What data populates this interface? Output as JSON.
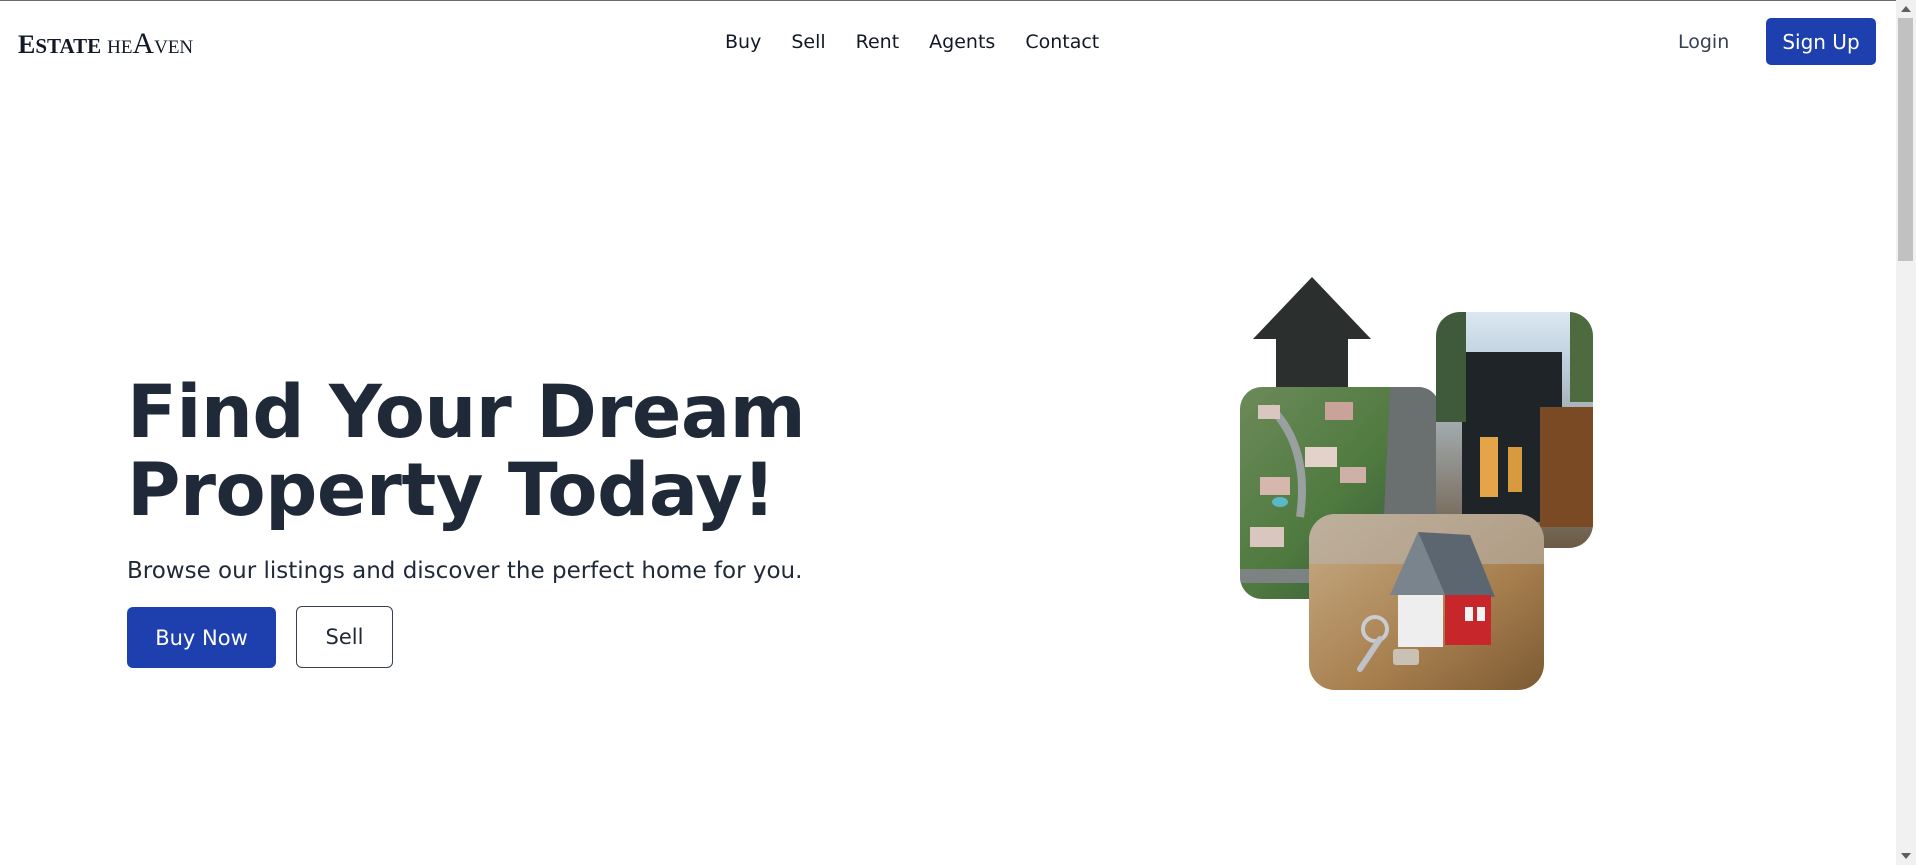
{
  "brand": {
    "word1_initial": "E",
    "word1_rest": "STATE",
    "word2_a": "HE",
    "word2_b": "A",
    "word2_c": "VEN"
  },
  "nav": {
    "items": [
      {
        "label": "Buy"
      },
      {
        "label": "Sell"
      },
      {
        "label": "Rent"
      },
      {
        "label": "Agents"
      },
      {
        "label": "Contact"
      }
    ]
  },
  "auth": {
    "login_label": "Login",
    "signup_label": "Sign Up"
  },
  "hero": {
    "title_line1": "Find Your Dream",
    "title_line2": "Property Today!",
    "subtitle": "Browse our listings and discover the perfect home for you.",
    "primary_cta": "Buy Now",
    "secondary_cta": "Sell"
  },
  "colors": {
    "accent": "#1e40af",
    "text": "#1f2937",
    "arrow": "#2b302e"
  },
  "icons": {
    "collage_arrow": "arrow-up-icon"
  }
}
